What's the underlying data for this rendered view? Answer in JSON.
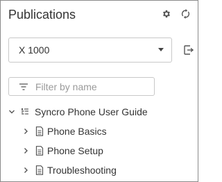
{
  "panel": {
    "title": "Publications",
    "settings_icon": "gear-icon",
    "sync_icon": "sync-icon"
  },
  "publication_select": {
    "value": "X 1000",
    "icon": "caret-down-icon"
  },
  "exit_icon": "open-external-icon",
  "filter": {
    "placeholder": "Filter by name",
    "icon": "filter-icon"
  },
  "tree": {
    "root": {
      "label": "Syncro Phone User Guide",
      "icon": "map-tree-icon",
      "expanded": true
    },
    "children": [
      {
        "label": "Phone Basics",
        "icon": "document-icon",
        "expanded": false
      },
      {
        "label": "Phone Setup",
        "icon": "document-icon",
        "expanded": false
      },
      {
        "label": "Troubleshooting",
        "icon": "document-icon",
        "expanded": false
      }
    ]
  },
  "colors": {
    "text": "#333333",
    "border": "#c8c8c8",
    "panel_border": "#8a8a8a",
    "placeholder": "#9a9a9a",
    "icon": "#444444"
  }
}
